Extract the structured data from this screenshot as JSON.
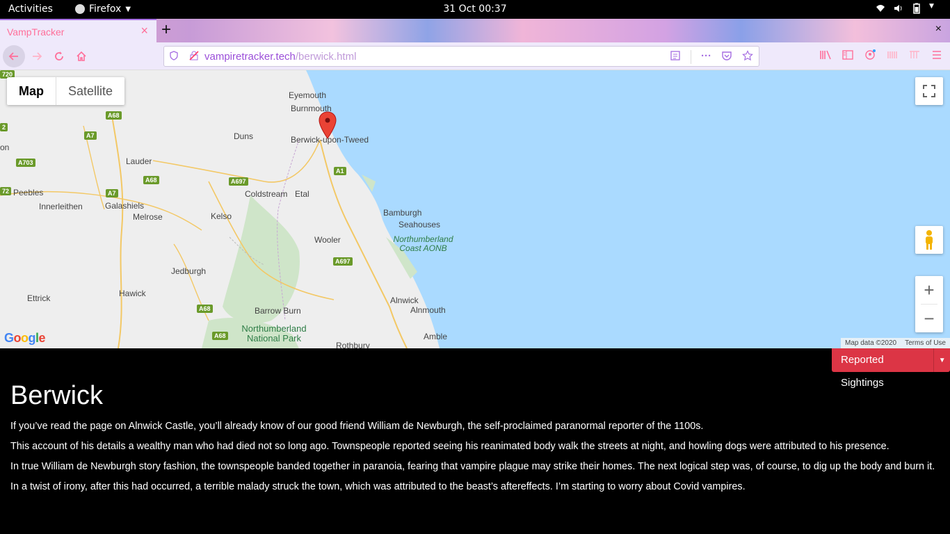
{
  "system": {
    "activities": "Activities",
    "app_name": "Firefox",
    "clock": "31 Oct  00:37"
  },
  "browser": {
    "tab_title": "VampTracker",
    "tab_close": "×",
    "new_tab": "+",
    "window_close": "×",
    "url_host": "vampiretracker.tech",
    "url_path": "/berwick.html"
  },
  "map": {
    "type_map": "Map",
    "type_satellite": "Satellite",
    "zoom_in": "+",
    "zoom_out": "−",
    "google": "Google",
    "map_data": "Map data ©2020",
    "terms": "Terms of Use",
    "places": {
      "eyemouth": "Eyemouth",
      "burnmouth": "Burnmouth",
      "duns": "Duns",
      "berwick": "Berwick-upon-Tweed",
      "lauder": "Lauder",
      "peebles": "Peebles",
      "innerleithen": "Innerleithen",
      "galashiels": "Galashiels",
      "melrose": "Melrose",
      "coldstream": "Coldstream",
      "etal": "Etal",
      "kelso": "Kelso",
      "bamburgh": "Bamburgh",
      "seahouses": "Seahouses",
      "wooler": "Wooler",
      "aonb": "Northumberland Coast AONB",
      "jedburgh": "Jedburgh",
      "hawick": "Hawick",
      "ettrick": "Ettrick",
      "alnwick": "Alnwick",
      "alnmouth": "Alnmouth",
      "barrow_burn": "Barrow Burn",
      "np": "Northumberland National Park",
      "rothbury": "Rothbury",
      "amble": "Amble",
      "on": "on"
    },
    "roads": {
      "a68_1": "A68",
      "a7_1": "A7",
      "a703": "A703",
      "a68_2": "A68",
      "a697_1": "A697",
      "a7_2": "A7",
      "a1": "A1",
      "a697_2": "A697",
      "a68_3": "A68",
      "a68_4": "A68",
      "a720": "720",
      "r2": "2",
      "r72": "72"
    }
  },
  "sightings": {
    "label": "Reported Sightings"
  },
  "article": {
    "title": "Berwick",
    "paragraphs": [
      "If you’ve read the page on Alnwick Castle, you’ll already know of our good friend William de Newburgh, the self-proclaimed paranormal reporter of the 1100s.",
      "This account of his details a wealthy man who had died not so long ago. Townspeople reported seeing his reanimated body walk the streets at night, and howling dogs were attributed to his presence.",
      "In true William de Newburgh story fashion, the townspeople banded together in paranoia, fearing that vampire plague may strike their homes. The next logical step was, of course, to dig up the body and burn it.",
      "In a twist of irony, after this had occurred, a terrible malady struck the town, which was attributed to the beast’s aftereffects. I’m starting to worry about Covid vampires."
    ]
  }
}
